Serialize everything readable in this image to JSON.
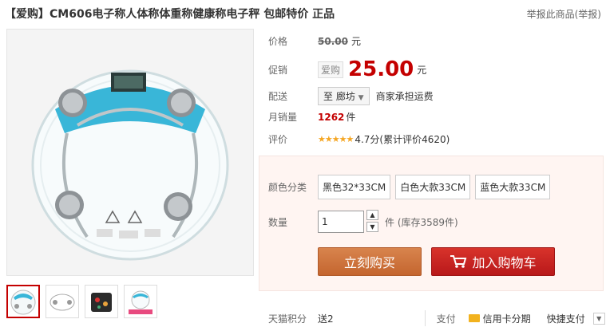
{
  "header": {
    "title": "【爱购】CM606电子称人体称体重称健康称电子秤 包邮特价 正品",
    "report_link": "举报此商品(举报)"
  },
  "price": {
    "label": "价格",
    "original": "50.00",
    "unit": "元"
  },
  "promo": {
    "label": "促销",
    "badge": "爱购",
    "price": "25.00",
    "unit": "元"
  },
  "delivery": {
    "label": "配送",
    "to": "至 廊坊",
    "note": "商家承担运费"
  },
  "monthly_sales": {
    "label": "月销量",
    "count": "1262",
    "unit": "件"
  },
  "rating": {
    "label": "评价",
    "stars": "★★★★★",
    "text": "4.7分(累计评价4620)"
  },
  "options": {
    "color_label": "颜色分类",
    "colors": [
      "黑色32*33CM",
      "白色大款33CM",
      "蓝色大款33CM"
    ],
    "qty_label": "数量",
    "qty_value": "1",
    "stock": "件 (库存3589件)"
  },
  "buttons": {
    "buy": "立刻购买",
    "cart": "加入购物车"
  },
  "footer": {
    "points_label": "天猫积分",
    "points": "送2",
    "pay_label": "支付",
    "credit": "信用卡分期",
    "quick_pay": "快捷支付"
  },
  "colors": {
    "accent": "#c40000",
    "buy": "#c8692f",
    "cart": "#c0201f"
  }
}
